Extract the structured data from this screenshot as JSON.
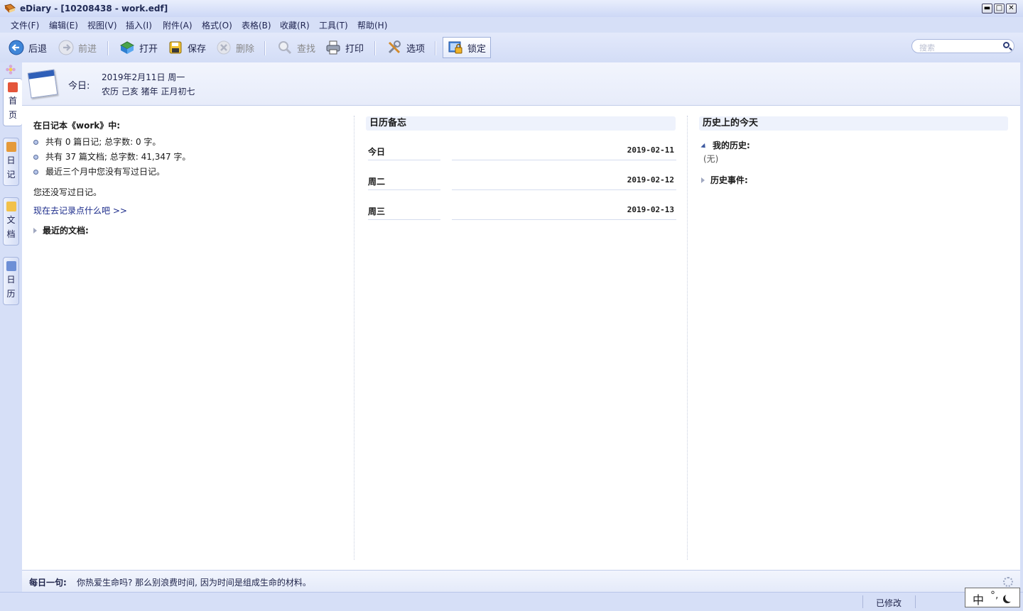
{
  "window": {
    "title": "eDiary - [10208438 - work.edf]",
    "controls": {
      "minimize": "▬",
      "maximize": "□",
      "close": "✕"
    }
  },
  "menu": [
    "文件(F)",
    "编辑(E)",
    "视图(V)",
    "插入(I)",
    "附件(A)",
    "格式(O)",
    "表格(B)",
    "收藏(R)",
    "工具(T)",
    "帮助(H)"
  ],
  "toolbar": {
    "back": "后退",
    "forward": "前进",
    "open": "打开",
    "save": "保存",
    "delete": "删除",
    "find": "查找",
    "print": "打印",
    "options": "选项",
    "lock": "锁定"
  },
  "search": {
    "placeholder": "搜索"
  },
  "sidetabs": [
    {
      "label": "首页",
      "chars": [
        "首",
        "页"
      ],
      "icon": "home-icon"
    },
    {
      "label": "日记",
      "chars": [
        "日",
        "记"
      ],
      "icon": "diary-icon"
    },
    {
      "label": "文档",
      "chars": [
        "文",
        "档"
      ],
      "icon": "document-icon"
    },
    {
      "label": "日历",
      "chars": [
        "日",
        "历"
      ],
      "icon": "calendar-icon"
    }
  ],
  "header": {
    "today_label": "今日:",
    "date_line": "2019年2月11日  周一",
    "lunar_line": "农历  己亥  猪年  正月初七"
  },
  "summary": {
    "notebook_title": "在日记本《work》中:",
    "bullets": [
      "共有 0 篇日记; 总字数: 0 字。",
      "共有 37 篇文档; 总字数: 41,347 字。",
      "最近三个月中您没有写过日记。"
    ],
    "no_diary_text": "您还没写过日记。",
    "write_link": "现在去记录点什么吧 >>",
    "recent_docs": "最近的文档:"
  },
  "memo": {
    "title": "日历备忘",
    "rows": [
      {
        "day": "今日",
        "date": "2019-02-11"
      },
      {
        "day": "周二",
        "date": "2019-02-12"
      },
      {
        "day": "周三",
        "date": "2019-02-13"
      }
    ]
  },
  "history": {
    "title": "历史上的今天",
    "my_history_label": "我的历史:",
    "my_history_value": "(无)",
    "events_label": "历史事件:"
  },
  "quote": {
    "label": "每日一句:",
    "text": "你热爱生命吗? 那么别浪费时间, 因为时间是组成生命的材料。"
  },
  "status": {
    "modified": "已修改"
  },
  "ime": {
    "lang": "中",
    "punct": "°,"
  },
  "colors": {
    "accent": "#2f5fb8",
    "frame": "#d6dff7",
    "link": "#1a2a8a"
  }
}
